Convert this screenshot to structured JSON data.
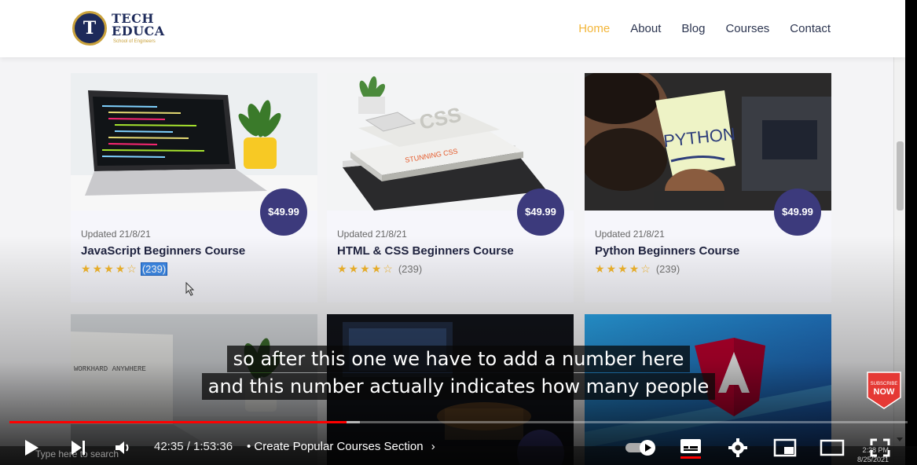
{
  "site": {
    "logo": {
      "line1": "TECH",
      "line2": "EDUCA",
      "badge": "T",
      "sub": "School of Engineers"
    },
    "nav": [
      {
        "label": "Home",
        "active": true
      },
      {
        "label": "About",
        "active": false
      },
      {
        "label": "Blog",
        "active": false
      },
      {
        "label": "Courses",
        "active": false
      },
      {
        "label": "Contact",
        "active": false
      }
    ],
    "accent_color": "#f3b63a",
    "price_badge_color": "#3c3a7c"
  },
  "courses": [
    {
      "price": "$49.99",
      "updated": "Updated 21/8/21",
      "title": "JavaScript Beginners Course",
      "stars": 4,
      "max_stars": 5,
      "count": "(239)",
      "count_selected": true,
      "image": "laptop-with-code"
    },
    {
      "price": "$49.99",
      "updated": "Updated 21/8/21",
      "title": "HTML & CSS Beginners Course",
      "stars": 4,
      "max_stars": 5,
      "count": "(239)",
      "count_selected": false,
      "image": "stack-of-books"
    },
    {
      "price": "$49.99",
      "updated": "Updated 21/8/21",
      "title": "Python Beginners Course",
      "stars": 4,
      "max_stars": 5,
      "count": "(239)",
      "count_selected": false,
      "image": "python-note"
    }
  ],
  "second_row": [
    {
      "image": "laptop-workhard",
      "screen_text": "WORKHARD ANYWHERE"
    },
    {
      "image": "dark-desk"
    },
    {
      "image": "angular-logo"
    }
  ],
  "player": {
    "subtitles": [
      "so after this one we have to add a number here",
      "and this number actually indicates how many people"
    ],
    "time": "42:35 / 1:53:36",
    "chapter": "• Create Popular Courses Section",
    "progress_played": 0.375,
    "progress_buffered": 0.39,
    "subscribe_label": "SUBSCRIBE NOW",
    "subscribe_small": "SUBSCRIBE",
    "subscribe_big": "NOW"
  },
  "taskbar": {
    "search_placeholder": "Type here to search",
    "time": "2:28 PM",
    "date": "8/25/2021"
  }
}
